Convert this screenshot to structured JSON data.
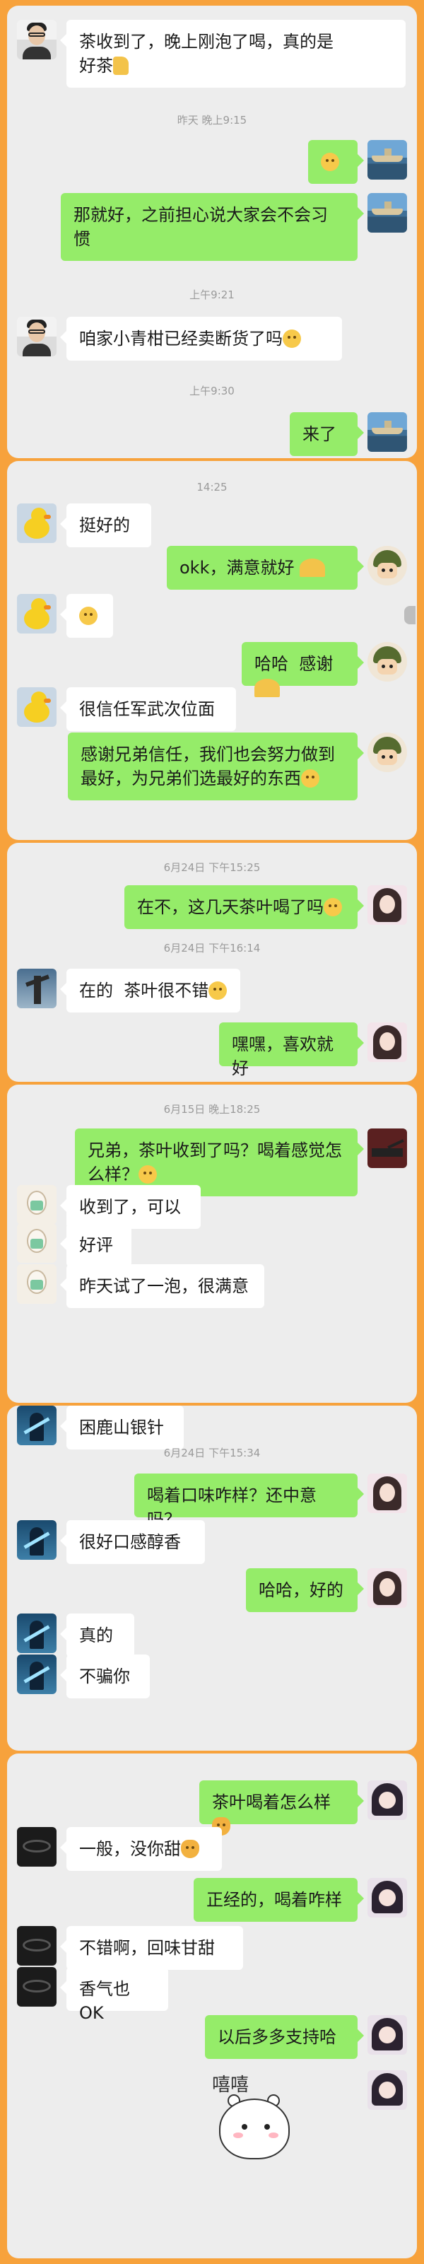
{
  "colors": {
    "frame": "#f7a23c",
    "panel": "#ededed",
    "bubble_sent": "#95ec69",
    "bubble_received": "#ffffff",
    "timestamp": "#9a9a9a"
  },
  "panels": [
    {
      "items": [
        {
          "kind": "msg",
          "side": "left",
          "avatar": "man-glasses",
          "text": "茶收到了，晚上刚泡了喝，真的是\n好茶",
          "emoji": "thumbs-up-icon"
        },
        {
          "kind": "ts",
          "text": "昨天 晚上9:15"
        },
        {
          "kind": "msg",
          "side": "right",
          "avatar": "boat",
          "text": "",
          "emoji": "smile-emoji-icon"
        },
        {
          "kind": "msg",
          "side": "right",
          "avatar": "boat",
          "text": "那就好，之前担心说大家会不会习\n惯",
          "emoji": ""
        },
        {
          "kind": "ts",
          "text": "上午9:21"
        },
        {
          "kind": "msg",
          "side": "left",
          "avatar": "man-glasses",
          "text": "咱家小青柑已经卖断货了吗",
          "emoji": "smile-emoji-icon"
        },
        {
          "kind": "ts",
          "text": "上午9:30"
        },
        {
          "kind": "msg",
          "side": "right",
          "avatar": "boat",
          "text": "来了",
          "emoji": ""
        }
      ]
    },
    {
      "items": [
        {
          "kind": "ts",
          "text": "14:25"
        },
        {
          "kind": "msg",
          "side": "left",
          "avatar": "duck",
          "text": "挺好的",
          "emoji": ""
        },
        {
          "kind": "msg",
          "side": "right",
          "avatar": "soldier",
          "text": "okk，满意就好 ",
          "emoji": "praying-hands-icon"
        },
        {
          "kind": "msg",
          "side": "left",
          "avatar": "duck",
          "text": "",
          "emoji": "smile-emoji-icon"
        },
        {
          "kind": "msg",
          "side": "right",
          "avatar": "soldier",
          "text": "哈哈  感谢",
          "emoji": "praying-hands-icon"
        },
        {
          "kind": "msg",
          "side": "left",
          "avatar": "duck",
          "text": "很信任军武次位面",
          "emoji": ""
        },
        {
          "kind": "msg",
          "side": "right",
          "avatar": "soldier",
          "text": "感谢兄弟信任，我们也会努力做到\n最好，为兄弟们选最好的东西",
          "emoji": "grin-emoji-icon"
        }
      ]
    },
    {
      "items": [
        {
          "kind": "ts",
          "text": "6月24日 下午15:25"
        },
        {
          "kind": "msg",
          "side": "right",
          "avatar": "girl",
          "text": "在不，这几天茶叶喝了吗",
          "emoji": "smile-emoji-icon"
        },
        {
          "kind": "ts",
          "text": "6月24日 下午16:14"
        },
        {
          "kind": "msg",
          "side": "left",
          "avatar": "statue",
          "text": "在的  茶叶很不错",
          "emoji": "sunglasses-emoji-icon"
        },
        {
          "kind": "msg",
          "side": "right",
          "avatar": "girl",
          "text": "嘿嘿，喜欢就好",
          "emoji": ""
        }
      ]
    },
    {
      "items": [
        {
          "kind": "ts",
          "text": "6月15日 晚上18:25"
        },
        {
          "kind": "msg",
          "side": "right",
          "avatar": "tank",
          "text": "兄弟，茶叶收到了吗？喝着感觉怎\n么样？",
          "emoji": "smile-emoji-icon"
        },
        {
          "kind": "msg",
          "side": "left",
          "avatar": "sketch",
          "text": "收到了，可以",
          "emoji": ""
        },
        {
          "kind": "msg",
          "side": "left",
          "avatar": "sketch",
          "text": "好评",
          "emoji": ""
        },
        {
          "kind": "msg",
          "side": "left",
          "avatar": "sketch",
          "text": "昨天试了一泡，很满意",
          "emoji": ""
        }
      ]
    },
    {
      "items": [
        {
          "kind": "msg",
          "side": "left",
          "avatar": "sword",
          "text": "困鹿山银针",
          "emoji": ""
        },
        {
          "kind": "ts",
          "text": "6月24日 下午15:34"
        },
        {
          "kind": "msg",
          "side": "right",
          "avatar": "girl2",
          "text": "喝着口味咋样？还中意吗？",
          "emoji": ""
        },
        {
          "kind": "msg",
          "side": "left",
          "avatar": "sword",
          "text": "很好口感醇香",
          "emoji": ""
        },
        {
          "kind": "msg",
          "side": "right",
          "avatar": "girl2",
          "text": "哈哈，好的",
          "emoji": ""
        },
        {
          "kind": "msg",
          "side": "left",
          "avatar": "sword",
          "text": "真的",
          "emoji": ""
        },
        {
          "kind": "msg",
          "side": "left",
          "avatar": "sword",
          "text": "不骗你",
          "emoji": ""
        }
      ]
    },
    {
      "items": [
        {
          "kind": "msg",
          "side": "right",
          "avatar": "anime",
          "text": "茶叶喝着怎么样",
          "emoji": "cat-emoji-icon"
        },
        {
          "kind": "msg",
          "side": "left",
          "avatar": "dark",
          "text": "一般，没你甜",
          "emoji": "cat-emoji-icon"
        },
        {
          "kind": "msg",
          "side": "right",
          "avatar": "anime",
          "text": "正经的，喝着咋样",
          "emoji": ""
        },
        {
          "kind": "msg",
          "side": "left",
          "avatar": "dark",
          "text": "不错啊，回味甘甜",
          "emoji": ""
        },
        {
          "kind": "msg",
          "side": "left",
          "avatar": "dark",
          "text": "香气也 OK",
          "emoji": ""
        },
        {
          "kind": "msg",
          "side": "right",
          "avatar": "anime",
          "text": "以后多多支持哈",
          "emoji": ""
        },
        {
          "kind": "sticker",
          "side": "right",
          "avatar": "anime",
          "text": "嘻嘻"
        }
      ]
    }
  ]
}
